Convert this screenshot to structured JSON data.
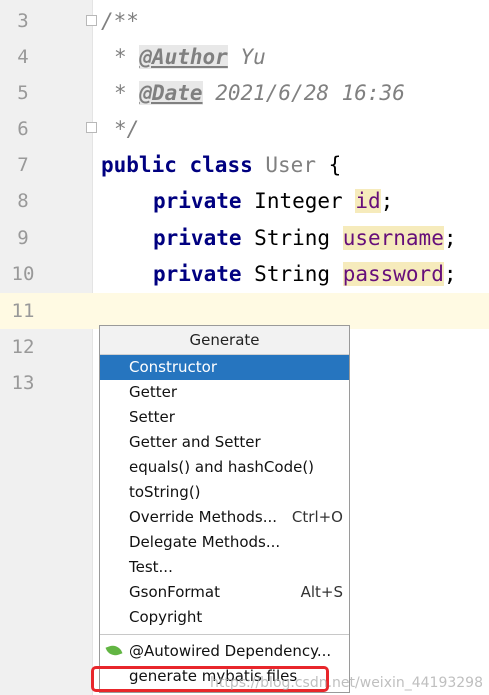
{
  "editor": {
    "line_numbers": [
      "3",
      "4",
      "5",
      "6",
      "7",
      "8",
      "9",
      "10",
      "11",
      "12",
      "13"
    ],
    "comment_open": "/**",
    "author_tag": "@Author",
    "author_value": "Yu",
    "date_tag": "@Date",
    "date_value": "2021/6/28 16:36",
    "comment_close": "*/",
    "comment_star": "*",
    "kw_public": "public",
    "kw_class": "class",
    "class_name": "User",
    "brace": "{",
    "kw_private": "private",
    "type_integer": "Integer",
    "type_string": "String",
    "field_id": "id",
    "field_username": "username",
    "field_password": "password",
    "semicolon": ";"
  },
  "menu": {
    "title": "Generate",
    "items": [
      {
        "label": "Constructor",
        "shortcut": ""
      },
      {
        "label": "Getter",
        "shortcut": ""
      },
      {
        "label": "Setter",
        "shortcut": ""
      },
      {
        "label": "Getter and Setter",
        "shortcut": ""
      },
      {
        "label": "equals() and hashCode()",
        "shortcut": ""
      },
      {
        "label": "toString()",
        "shortcut": ""
      },
      {
        "label": "Override Methods...",
        "shortcut": "Ctrl+O"
      },
      {
        "label": "Delegate Methods...",
        "shortcut": ""
      },
      {
        "label": "Test...",
        "shortcut": ""
      },
      {
        "label": "GsonFormat",
        "shortcut": "Alt+S"
      },
      {
        "label": "Copyright",
        "shortcut": ""
      }
    ],
    "plugin_items": [
      {
        "label": "@Autowired Dependency...",
        "icon": "spring-leaf-icon"
      },
      {
        "label": "generate mybatis files"
      }
    ],
    "selected_color": "#2675bf"
  },
  "watermark": "https://blog.csdn.net/weixin_44193298"
}
